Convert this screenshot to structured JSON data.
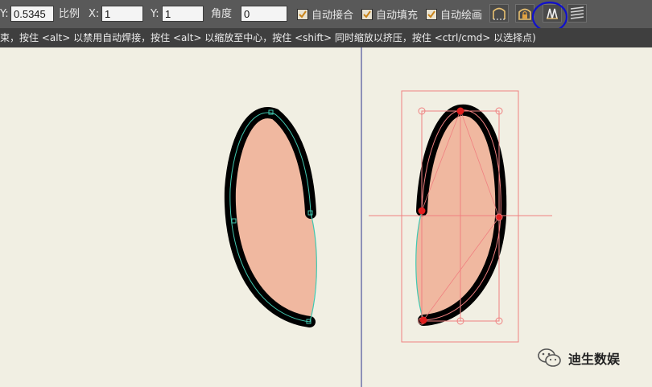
{
  "toolbar": {
    "y_prefix": "Y:",
    "y_value": "0.5345",
    "scale_label": "比例",
    "scale_x_label": "X:",
    "scale_x_value": "1",
    "scale_y_label": "Y:",
    "scale_y_value": "1",
    "angle_label": "角度",
    "angle_value": "0",
    "checkboxes": [
      {
        "label": "自动接合",
        "checked": true
      },
      {
        "label": "自动填充",
        "checked": true
      },
      {
        "label": "自动绘画",
        "checked": true
      }
    ],
    "tool_icons": [
      "close-shape-icon",
      "fill-lock-icon",
      "auto-draw-icon",
      "stroke-order-icon"
    ],
    "active_tool": "auto-draw-icon",
    "highlight_color": "#1010cc"
  },
  "hint": {
    "text": "束，按住 <alt> 以禁用自动焊接，按住 <alt> 以缩放至中心，按住 <shift> 同时缩放以挤压，按住 <ctrl/cmd> 以选择点)"
  },
  "colors": {
    "fill": "#f0b8a0",
    "stroke": "#000000",
    "selection": "#f08080",
    "control_point": "#e02020",
    "path_line": "#40c8b0"
  },
  "watermark": {
    "text": "迪生数娱",
    "icon": "wechat-icon"
  }
}
